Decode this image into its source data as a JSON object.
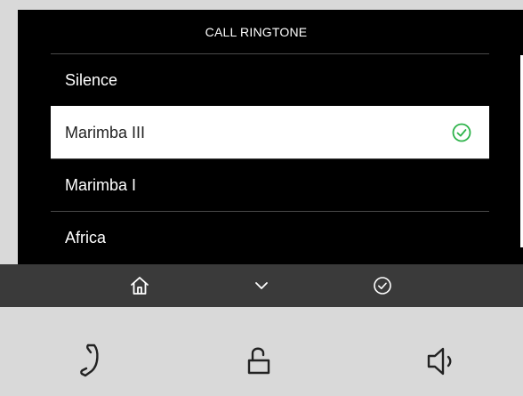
{
  "screen": {
    "title": "CALL RINGTONE"
  },
  "ringtones": [
    {
      "label": "Silence",
      "selected": false
    },
    {
      "label": "Marimba III",
      "selected": true
    },
    {
      "label": "Marimba I",
      "selected": false
    },
    {
      "label": "Africa",
      "selected": false
    }
  ],
  "navbar": {
    "icons": [
      "home-icon",
      "chevron-down-icon",
      "confirm-check-icon"
    ]
  },
  "hardware_buttons": {
    "icons": [
      "phone-handset-icon",
      "unlock-icon",
      "speaker-icon"
    ]
  },
  "colors": {
    "accent_green": "#2db34a",
    "screen_bg": "#000000",
    "navbar_bg": "#3a3a3a",
    "panel_bg": "#d9d9d9"
  }
}
